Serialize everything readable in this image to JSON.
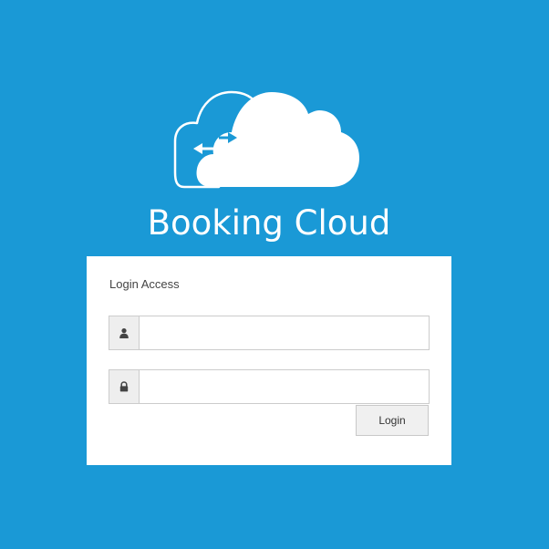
{
  "brand": {
    "logo_icon": "cloud-sync-icon",
    "name": "Booking Cloud"
  },
  "login": {
    "title": "Login Access",
    "username": {
      "icon": "user-icon",
      "value": "",
      "placeholder": ""
    },
    "password": {
      "icon": "lock-icon",
      "value": "",
      "placeholder": ""
    },
    "submit_label": "Login"
  },
  "colors": {
    "background": "#1a99d6",
    "panel": "#ffffff",
    "field_border": "#cccccc",
    "addon_bg": "#eeeeee",
    "button_bg": "#f0f0f0"
  }
}
